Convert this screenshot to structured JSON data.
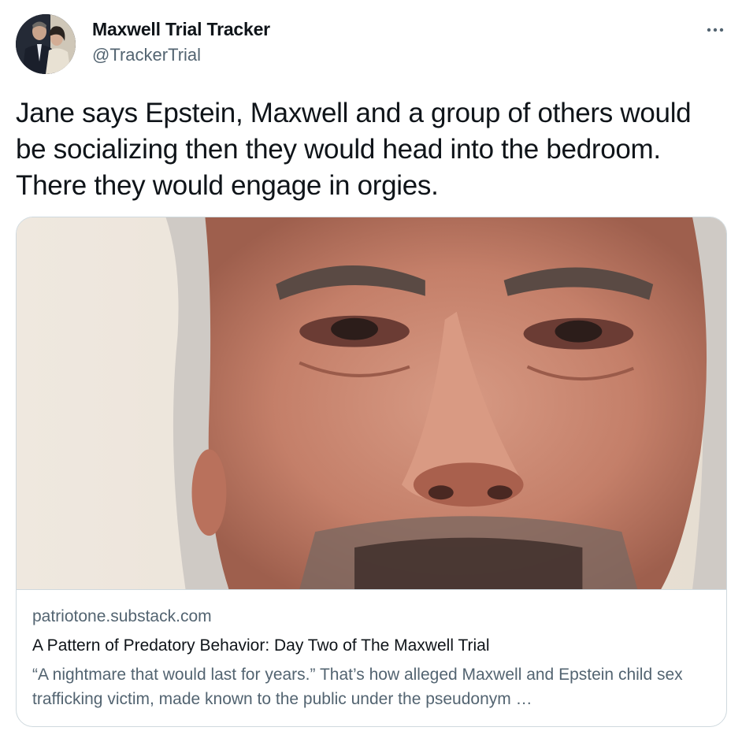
{
  "author": {
    "display_name": "Maxwell Trial Tracker",
    "handle": "@TrackerTrial",
    "avatar_icon": "profile-photo"
  },
  "more_icon": "ellipsis-icon",
  "tweet": {
    "text": "Jane says Epstein, Maxwell and a group of others would be socializing then they would head into the bedroom. There they would engage in orgies."
  },
  "card": {
    "image_icon": "article-photo",
    "domain": "patriotone.substack.com",
    "title": "A Pattern of Predatory Behavior: Day Two of The Maxwell Trial",
    "description": "“A nightmare that would last for years.” That’s how alleged Maxwell and Epstein child sex trafficking victim, made known to the public under the pseudonym …"
  },
  "colors": {
    "text_primary": "#0f1419",
    "text_secondary": "#536471",
    "border": "#cfd9de"
  }
}
